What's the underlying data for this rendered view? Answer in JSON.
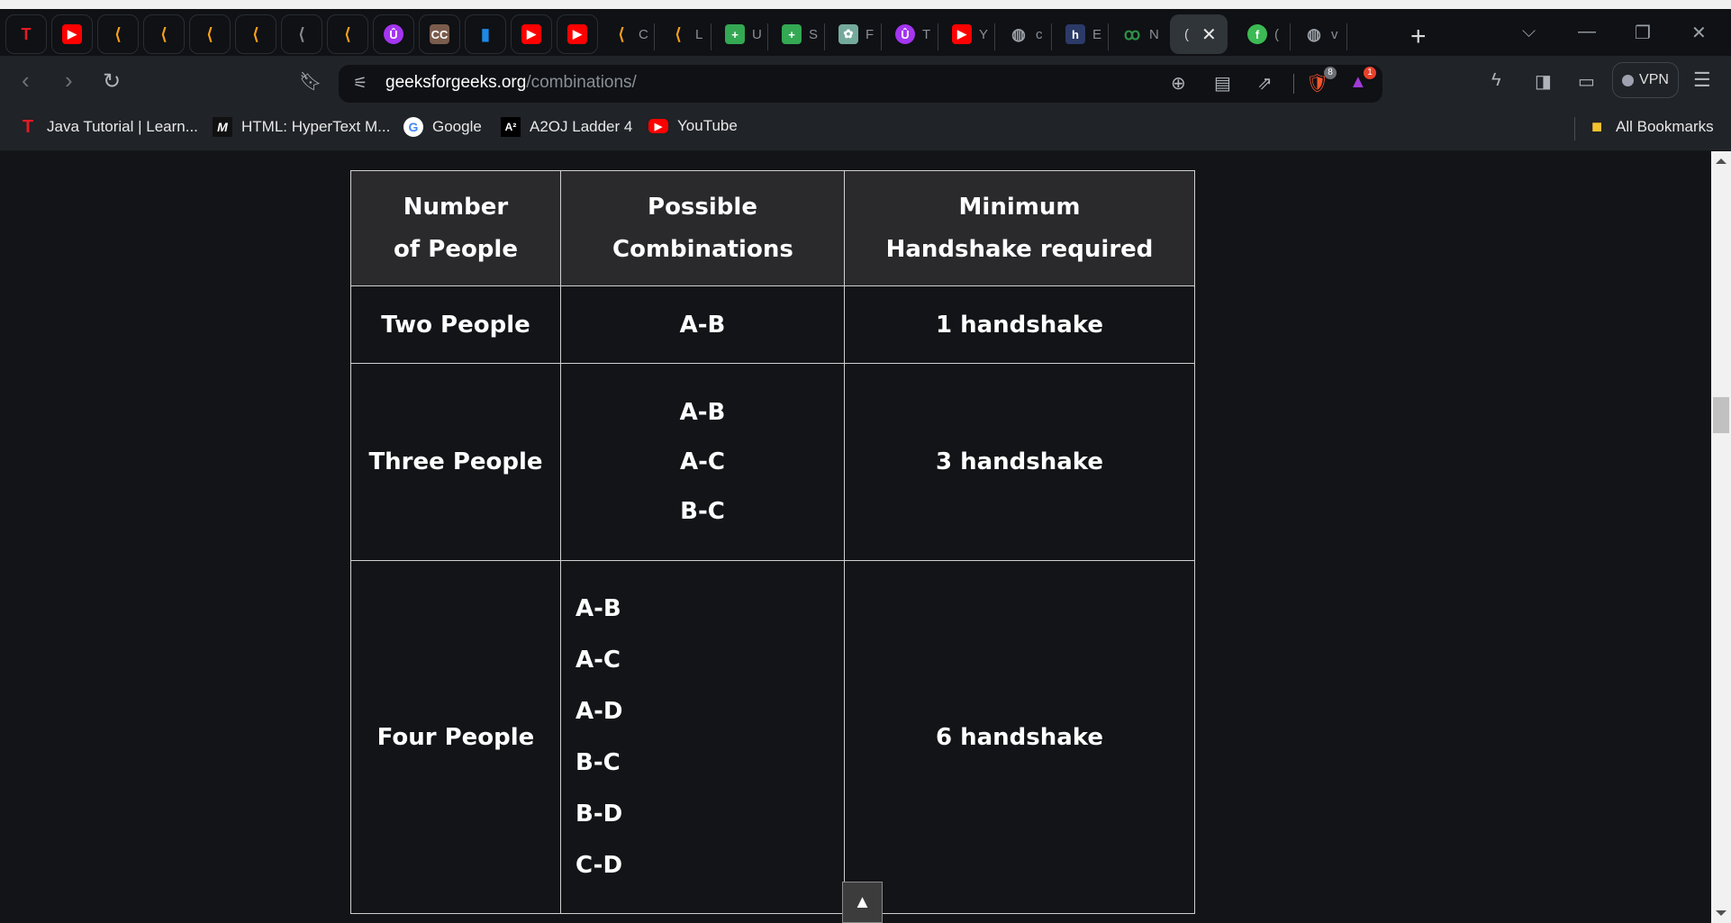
{
  "tabs": [
    {
      "title": "",
      "icon": "tutorialspoint-icon",
      "color": "#e31b23",
      "glyph": "T",
      "pinned": true
    },
    {
      "title": "",
      "icon": "youtube-icon",
      "color": "#ff0000",
      "glyph": "▶",
      "pinned": true
    },
    {
      "title": "",
      "icon": "leetcode-icon",
      "color": "#f89f1b",
      "glyph": "⟨",
      "pinned": true
    },
    {
      "title": "",
      "icon": "leetcode-icon",
      "color": "#f89f1b",
      "glyph": "⟨",
      "pinned": true
    },
    {
      "title": "",
      "icon": "leetcode-icon",
      "color": "#f89f1b",
      "glyph": "⟨",
      "pinned": true
    },
    {
      "title": "",
      "icon": "leetcode-icon",
      "color": "#f89f1b",
      "glyph": "⟨",
      "pinned": true
    },
    {
      "title": "",
      "icon": "leetcode-gray-icon",
      "color": "#888888",
      "glyph": "⟨",
      "pinned": true
    },
    {
      "title": "",
      "icon": "leetcode-icon",
      "color": "#f89f1b",
      "glyph": "⟨",
      "pinned": true
    },
    {
      "title": "",
      "icon": "udemy-icon",
      "color": "#a435f0",
      "glyph": "Û",
      "pinned": true
    },
    {
      "title": "",
      "icon": "cc-icon",
      "color": "#7a5c4c",
      "glyph": "CC",
      "pinned": true
    },
    {
      "title": "",
      "icon": "chart-bars-icon",
      "color": "#1e88e5",
      "glyph": "▮",
      "pinned": true
    },
    {
      "title": "",
      "icon": "youtube-icon",
      "color": "#ff0000",
      "glyph": "▶",
      "pinned": true
    },
    {
      "title": "",
      "icon": "youtube-icon",
      "color": "#ff0000",
      "glyph": "▶",
      "pinned": true
    },
    {
      "title": "C",
      "icon": "leetcode-icon",
      "color": "#f89f1b",
      "glyph": "⟨"
    },
    {
      "title": "L",
      "icon": "leetcode-icon",
      "color": "#f89f1b",
      "glyph": "⟨"
    },
    {
      "title": "U",
      "icon": "google-sheets-icon",
      "color": "#34a853",
      "glyph": "+"
    },
    {
      "title": "S",
      "icon": "google-sheets-icon",
      "color": "#34a853",
      "glyph": "+"
    },
    {
      "title": "F",
      "icon": "chatgpt-icon",
      "color": "#74aa9c",
      "glyph": "✿"
    },
    {
      "title": "T",
      "icon": "udemy-icon",
      "color": "#a435f0",
      "glyph": "Û"
    },
    {
      "title": "Y",
      "icon": "youtube-icon",
      "color": "#ff0000",
      "glyph": "▶"
    },
    {
      "title": "c",
      "icon": "globe-icon",
      "color": "#9aa0a6",
      "glyph": "◍"
    },
    {
      "title": "E",
      "icon": "hashnode-icon",
      "color": "#2b3a67",
      "glyph": "h"
    },
    {
      "title": "N",
      "icon": "geeksforgeeks-icon",
      "color": "#2f8d46",
      "glyph": "ꝏ"
    },
    {
      "title": "(",
      "icon": "page-icon",
      "color": "#30353a",
      "glyph": "",
      "active": true
    },
    {
      "title": "(",
      "icon": "fiverr-icon",
      "color": "#3cba54",
      "glyph": "f"
    },
    {
      "title": "v",
      "icon": "globe-icon",
      "color": "#9aa0a6",
      "glyph": "◍"
    }
  ],
  "toolbar": {
    "url_domain": "geeksforgeeks.org",
    "url_path": "/combinations/",
    "brave_shields_count": "8",
    "rewards_count": "1",
    "vpn_label": "VPN"
  },
  "bookmarks": [
    {
      "label": "Java Tutorial | Learn...",
      "icon": "tutorialspoint-icon",
      "glyph": "T",
      "color": "#e31b23"
    },
    {
      "label": "HTML: HyperText M...",
      "icon": "mdn-icon",
      "glyph": "M",
      "color": "#ffffff"
    },
    {
      "label": "Google",
      "icon": "google-icon",
      "glyph": "G",
      "color": "#4285f4"
    },
    {
      "label": "A2OJ Ladder 4",
      "icon": "a2oj-icon",
      "glyph": "A²",
      "color": "#ffffff"
    },
    {
      "label": "YouTube",
      "icon": "youtube-icon",
      "glyph": "▶",
      "color": "#ff0000"
    }
  ],
  "all_bookmarks_label": "All Bookmarks",
  "table": {
    "headers": [
      "Number of People",
      "Possible Combinations",
      "Minimum Handshake required"
    ],
    "rows": [
      {
        "people": "Two People",
        "combinations": [
          "A-B"
        ],
        "handshakes": "1 handshake"
      },
      {
        "people": "Three People",
        "combinations": [
          "A-B",
          "A-C",
          "B-C"
        ],
        "handshakes": "3 handshake"
      },
      {
        "people": "Four People",
        "combinations": [
          "A-B",
          "A-C",
          "A-D",
          "B-C",
          "B-D",
          "C-D"
        ],
        "handshakes": "6 handshake"
      }
    ]
  },
  "scroll_to_top_glyph": "▲"
}
